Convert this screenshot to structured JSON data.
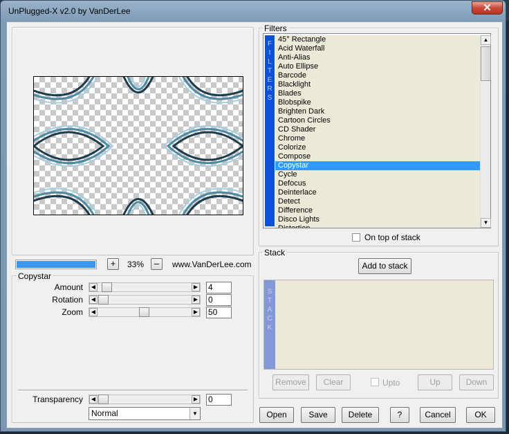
{
  "window": {
    "title": "UnPlugged-X v2.0 by VanDerLee",
    "close_label": "✕"
  },
  "filters": {
    "legend": "Filters",
    "strip_label": [
      "F",
      "I",
      "L",
      "T",
      "E",
      "R",
      "S"
    ],
    "items": [
      "45° Rectangle",
      "Acid Waterfall",
      "Anti-Alias",
      "Auto Ellipse",
      "Barcode",
      "Blacklight",
      "Blades",
      "Blobspike",
      "Brighten Dark",
      "Cartoon Circles",
      "CD Shader",
      "Chrome",
      "Colorize",
      "Compose",
      "Copystar",
      "Cycle",
      "Defocus",
      "Deinterlace",
      "Detect",
      "Difference",
      "Disco Lights",
      "Distortion"
    ],
    "selected_index": 14,
    "on_top_label": "On top of stack",
    "on_top_checked": false
  },
  "zoom": {
    "plus_label": "+",
    "minus_label": "–",
    "value": "33%",
    "website": "www.VanDerLee.com",
    "progress": 1.0
  },
  "params": {
    "legend": "Copystar",
    "rows": [
      {
        "label": "Amount",
        "value": "4",
        "pos": 0.04
      },
      {
        "label": "Rotation",
        "value": "0",
        "pos": 0.0
      },
      {
        "label": "Zoom",
        "value": "50",
        "pos": 0.5
      }
    ]
  },
  "transparency": {
    "label": "Transparency",
    "value": "0",
    "pos": 0.0,
    "mode": "Normal"
  },
  "stack": {
    "legend": "Stack",
    "add_label": "Add to stack",
    "strip_label": [
      "S",
      "T",
      "A",
      "C",
      "K"
    ],
    "remove_label": "Remove",
    "clear_label": "Clear",
    "upto_label": "Upto",
    "up_label": "Up",
    "down_label": "Down"
  },
  "buttons": {
    "open": "Open",
    "save": "Save",
    "delete": "Delete",
    "help": "?",
    "cancel": "Cancel",
    "ok": "OK"
  },
  "colors": {
    "filter_strip": "#0d52d6",
    "selection": "#3399ff",
    "stack_strip": "#8498d8",
    "pattern": "#3d6f86"
  }
}
